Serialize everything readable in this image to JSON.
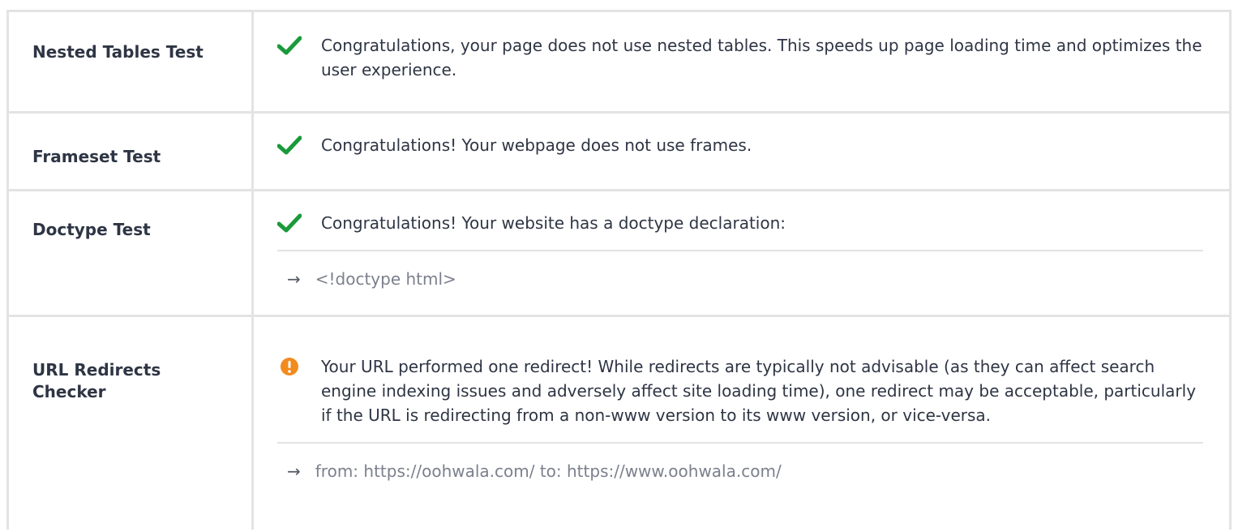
{
  "colors": {
    "pass": "#1a9a3a",
    "warn": "#f28b1e",
    "border": "#e3e3e3"
  },
  "rows": [
    {
      "label": "Nested Tables Test",
      "status_icon": "check-icon",
      "message": "Congratulations, your page does not use nested tables. This speeds up page loading time and optimizes the user experience."
    },
    {
      "label": "Frameset Test",
      "status_icon": "check-icon",
      "message": "Congratulations! Your webpage does not use frames."
    },
    {
      "label": "Doctype Test",
      "status_icon": "check-icon",
      "message": "Congratulations! Your website has a doctype declaration:",
      "detail": "<!doctype html>"
    },
    {
      "label": "URL Redirects Checker",
      "status_icon": "warning-icon",
      "message": "Your URL performed one redirect! While redirects are typically not advisable (as they can affect search engine indexing issues and adversely affect site loading time), one redirect may be acceptable, particularly if the URL is redirecting from a non-www version to its www version, or vice-versa.",
      "detail": "from: https://oohwala.com/ to: https://www.oohwala.com/"
    }
  ],
  "detail_arrow_icon": "arrow-right-icon"
}
